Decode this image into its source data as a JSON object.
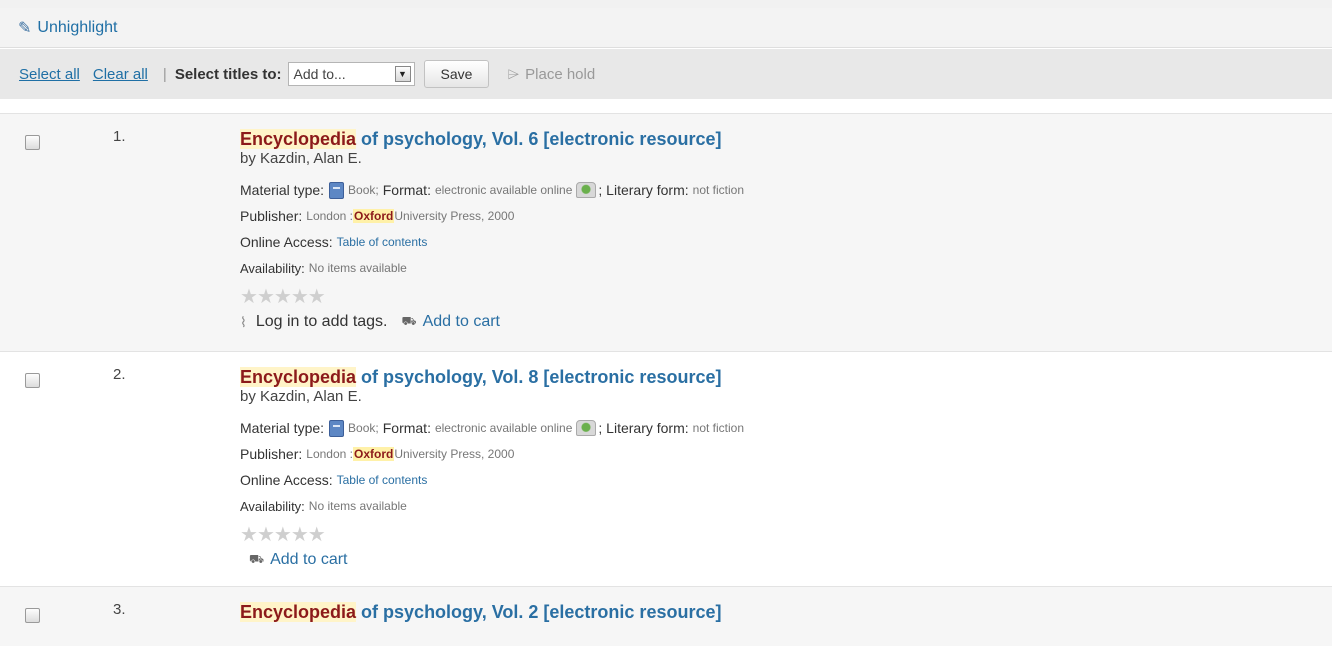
{
  "toolbar": {
    "unhighlight_label": "Unhighlight",
    "select_all_label": "Select all",
    "clear_all_label": "Clear all",
    "separator": "|",
    "select_titles_label": "Select titles to:",
    "add_to_value": "Add to...",
    "save_label": "Save",
    "place_hold_label": "Place hold"
  },
  "icons": {
    "unhighlight": "brush-icon",
    "place_hold": "hold-icon",
    "material": "book-icon",
    "format": "online-resource-icon",
    "tags": "tag-icon",
    "cart": "cart-icon"
  },
  "labels": {
    "material_type": "Material type:",
    "format": "Format:",
    "literary_form": "Literary form:",
    "publisher": "Publisher:",
    "online_access": "Online Access:",
    "availability": "Availability:",
    "log_in_tags": "Log in to add tags.",
    "add_to_cart": "Add to cart"
  },
  "results": [
    {
      "number": "1.",
      "title_hl": "Encyclopedia",
      "title_rest": " of psychology, Vol. 6 [electronic resource]",
      "author": "by Kazdin, Alan E.",
      "material_type": "Book;",
      "format": "electronic available online",
      "literary_form": "not fiction",
      "publisher_place": "London : ",
      "publisher_hl": "Oxford",
      "publisher_rest": " University Press, 2000",
      "online_access": "Table of contents",
      "availability": "No items available",
      "rating": 0
    },
    {
      "number": "2.",
      "title_hl": "Encyclopedia",
      "title_rest": " of psychology, Vol. 8 [electronic resource]",
      "author": "by Kazdin, Alan E.",
      "material_type": "Book;",
      "format": "electronic available online",
      "literary_form": "not fiction",
      "publisher_place": "London : ",
      "publisher_hl": "Oxford",
      "publisher_rest": " University Press, 2000",
      "online_access": "Table of contents",
      "availability": "No items available",
      "rating": 0
    },
    {
      "number": "3.",
      "title_hl": "Encyclopedia",
      "title_rest": " of psychology, Vol. 2 [electronic resource]"
    }
  ],
  "colors": {
    "link": "#2a6fa3",
    "highlight_text": "#8c1a1a",
    "highlight_bg": "#fff4c8"
  }
}
